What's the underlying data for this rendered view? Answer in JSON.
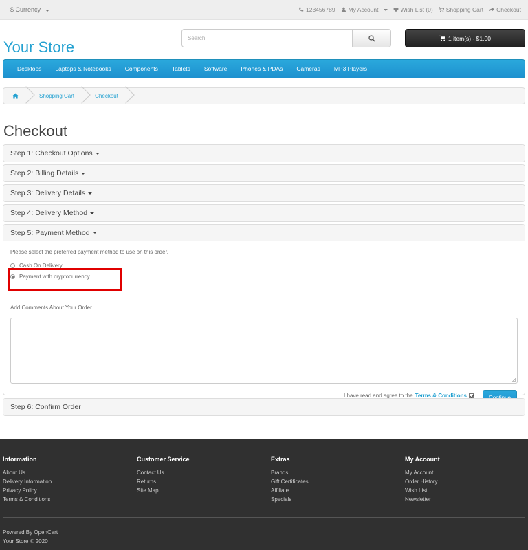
{
  "topbar": {
    "currency": "$ Currency",
    "phone": "123456789",
    "my_account": "My Account",
    "wish_list": "Wish List (0)",
    "shopping_cart": "Shopping Cart",
    "checkout": "Checkout"
  },
  "header": {
    "logo": "Your Store",
    "search_placeholder": "Search",
    "cart_button": "1 item(s) - $1.00"
  },
  "menu": [
    "Desktops",
    "Laptops & Notebooks",
    "Components",
    "Tablets",
    "Software",
    "Phones & PDAs",
    "Cameras",
    "MP3 Players"
  ],
  "breadcrumb": [
    "Shopping Cart",
    "Checkout"
  ],
  "page_title": "Checkout",
  "steps": [
    "Step 1: Checkout Options",
    "Step 2: Billing Details",
    "Step 3: Delivery Details",
    "Step 4: Delivery Method",
    "Step 5: Payment Method",
    "Step 6: Confirm Order"
  ],
  "payment": {
    "description": "Please select the preferred payment method to use on this order.",
    "options": [
      "Cash On Delivery",
      "Payment with cryptocurrency"
    ],
    "selected_index": 1,
    "comments_label": "Add Comments About Your Order",
    "agree_text": "I have read and agree to the",
    "terms_link": "Terms & Conditions",
    "agree_checked": true,
    "continue_label": "Continue"
  },
  "highlight_color": "#e00000",
  "accent_color": "#23a1d1",
  "footer": {
    "columns": [
      {
        "title": "Information",
        "links": [
          "About Us",
          "Delivery Information",
          "Privacy Policy",
          "Terms & Conditions"
        ]
      },
      {
        "title": "Customer Service",
        "links": [
          "Contact Us",
          "Returns",
          "Site Map"
        ]
      },
      {
        "title": "Extras",
        "links": [
          "Brands",
          "Gift Certificates",
          "Affiliate",
          "Specials"
        ]
      },
      {
        "title": "My Account",
        "links": [
          "My Account",
          "Order History",
          "Wish List",
          "Newsletter"
        ]
      }
    ],
    "powered_by": "Powered By",
    "powered_link": "OpenCart",
    "copyright": "Your Store © 2020"
  }
}
